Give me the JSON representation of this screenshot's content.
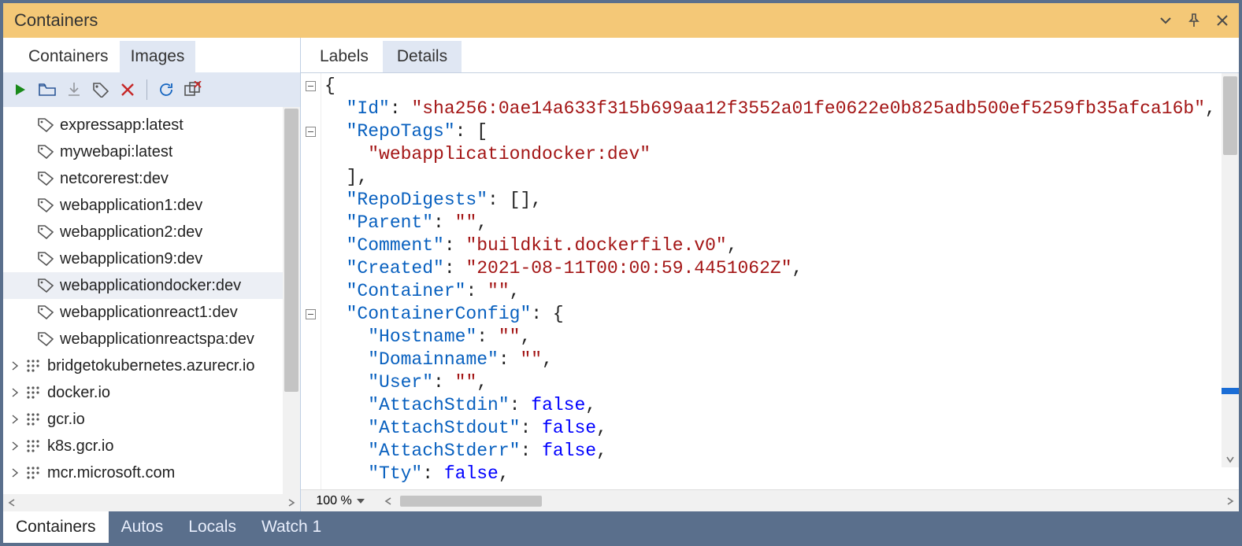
{
  "window": {
    "title": "Containers"
  },
  "left_tabs": {
    "containers": "Containers",
    "images": "Images",
    "active": "images"
  },
  "right_tabs": {
    "labels": "Labels",
    "details": "Details",
    "active": "details"
  },
  "zoom": "100 %",
  "images_list": [
    {
      "kind": "tag",
      "label": "expressapp:latest"
    },
    {
      "kind": "tag",
      "label": "mywebapi:latest"
    },
    {
      "kind": "tag",
      "label": "netcorerest:dev"
    },
    {
      "kind": "tag",
      "label": "webapplication1:dev"
    },
    {
      "kind": "tag",
      "label": "webapplication2:dev"
    },
    {
      "kind": "tag",
      "label": "webapplication9:dev"
    },
    {
      "kind": "tag",
      "label": "webapplicationdocker:dev",
      "selected": true
    },
    {
      "kind": "tag",
      "label": "webapplicationreact1:dev"
    },
    {
      "kind": "tag",
      "label": "webapplicationreactspa:dev"
    },
    {
      "kind": "reg",
      "label": "bridgetokubernetes.azurecr.io",
      "expandable": true
    },
    {
      "kind": "reg",
      "label": "docker.io",
      "expandable": true
    },
    {
      "kind": "reg",
      "label": "gcr.io",
      "expandable": true
    },
    {
      "kind": "reg",
      "label": "k8s.gcr.io",
      "expandable": true
    },
    {
      "kind": "reg",
      "label": "mcr.microsoft.com",
      "expandable": true
    }
  ],
  "json_details": {
    "Id": "sha256:0ae14a633f315b699aa12f3552a01fe0622e0b825adb500ef5259fb35afca16b",
    "RepoTags": [
      "webapplicationdocker:dev"
    ],
    "RepoDigests": [],
    "Parent": "",
    "Comment": "buildkit.dockerfile.v0",
    "Created": "2021-08-11T00:00:59.4451062Z",
    "Container": "",
    "ContainerConfig": {
      "Hostname": "",
      "Domainname": "",
      "User": "",
      "AttachStdin": false,
      "AttachStdout": false,
      "AttachStderr": false,
      "Tty": false
    }
  },
  "status_tabs": {
    "containers": "Containers",
    "autos": "Autos",
    "locals": "Locals",
    "watch1": "Watch 1",
    "active": "containers"
  }
}
